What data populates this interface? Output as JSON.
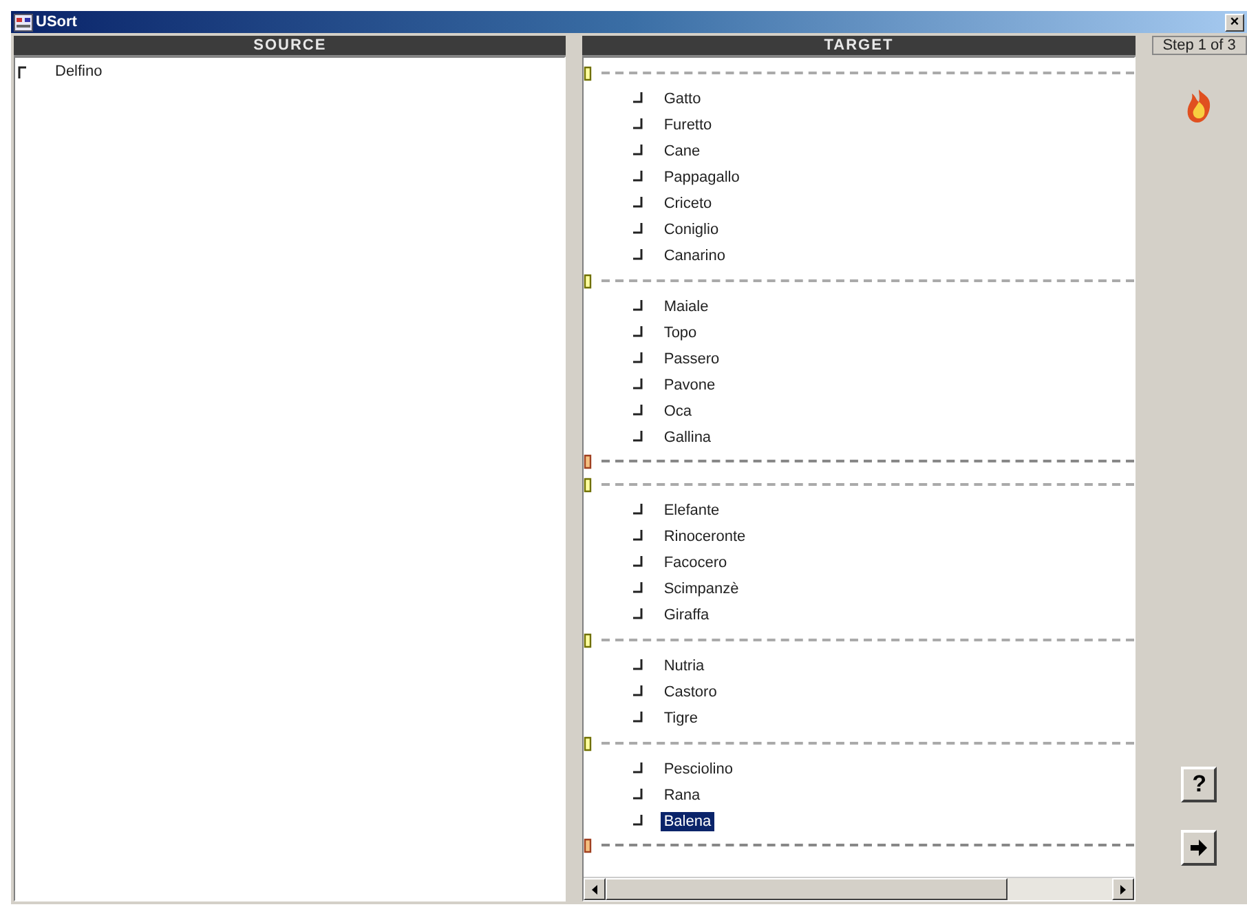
{
  "window": {
    "title": "USort",
    "close": "×"
  },
  "source": {
    "heading": "SOURCE",
    "items": [
      {
        "label": "Delfino",
        "selected": false
      }
    ]
  },
  "target": {
    "heading": "TARGET",
    "groups": [
      {
        "closed": false,
        "items": [
          {
            "label": "Gatto",
            "selected": false
          },
          {
            "label": "Furetto",
            "selected": false
          },
          {
            "label": "Cane",
            "selected": false
          },
          {
            "label": "Pappagallo",
            "selected": false
          },
          {
            "label": "Criceto",
            "selected": false
          },
          {
            "label": "Coniglio",
            "selected": false
          },
          {
            "label": "Canarino",
            "selected": false
          }
        ]
      },
      {
        "closed": true,
        "items": [
          {
            "label": "Maiale",
            "selected": false
          },
          {
            "label": "Topo",
            "selected": false
          },
          {
            "label": "Passero",
            "selected": false
          },
          {
            "label": "Pavone",
            "selected": false
          },
          {
            "label": "Oca",
            "selected": false
          },
          {
            "label": "Gallina",
            "selected": false
          }
        ]
      },
      {
        "closed": false,
        "items": [
          {
            "label": "Elefante",
            "selected": false
          },
          {
            "label": "Rinoceronte",
            "selected": false
          },
          {
            "label": "Facocero",
            "selected": false
          },
          {
            "label": "Scimpanzè",
            "selected": false
          },
          {
            "label": "Giraffa",
            "selected": false
          }
        ]
      },
      {
        "closed": false,
        "items": [
          {
            "label": "Nutria",
            "selected": false
          },
          {
            "label": "Castoro",
            "selected": false
          },
          {
            "label": "Tigre",
            "selected": false
          }
        ]
      },
      {
        "closed": true,
        "items": [
          {
            "label": "Pesciolino",
            "selected": false
          },
          {
            "label": "Rana",
            "selected": false
          },
          {
            "label": "Balena",
            "selected": true
          }
        ]
      }
    ]
  },
  "sidebar": {
    "step": "Step 1 of 3",
    "help_button": "?"
  }
}
